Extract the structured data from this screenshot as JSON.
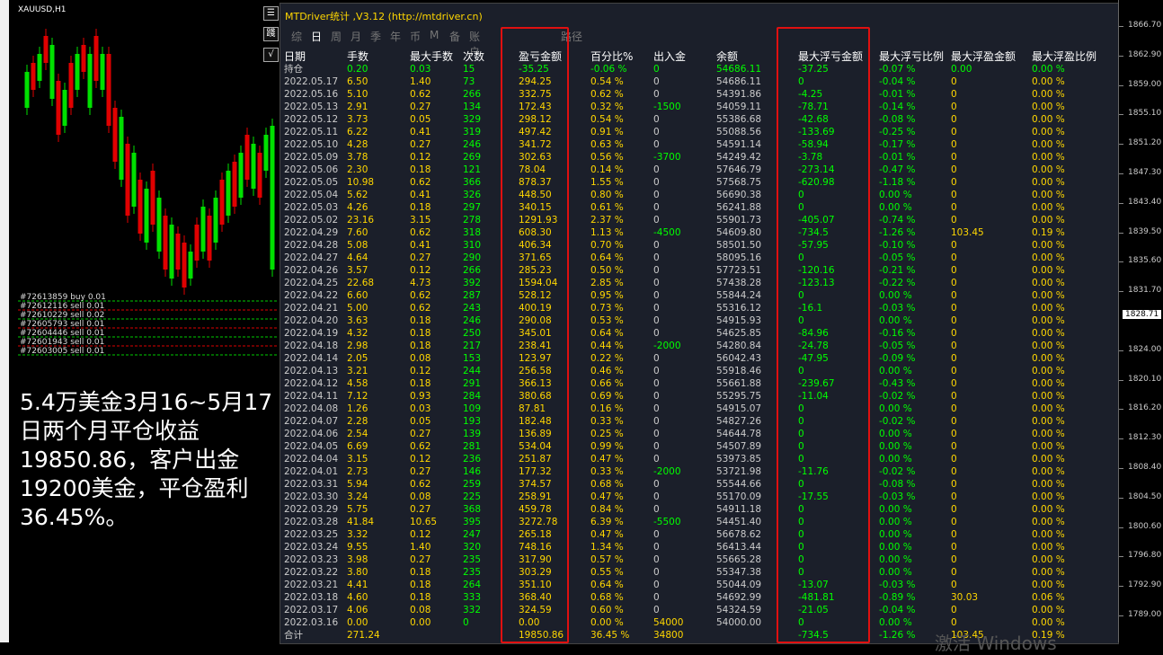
{
  "chart": {
    "symbol": "XAUUSD,H1",
    "orders": [
      "#72613859 buy 0.01",
      "#72612116 sell 0.01",
      "#72610229 sell 0.02",
      "#72605793 sell 0.01",
      "#72604446 sell 0.01",
      "#72601943 sell 0.01",
      "#72603005 sell 0.01"
    ],
    "overlay_text": "5.4万美金3月16~5月17日两个月平仓收益19850.86，客户出金19200美金，平仓盈利36.45%。",
    "buttons": [
      "☰",
      "踐",
      "√"
    ]
  },
  "panel": {
    "title": "MTDriver统计 ,V3.12 (http://mtdriver.cn)",
    "tabs": [
      "综",
      "日",
      "周",
      "月",
      "季",
      "年",
      "币",
      "M",
      "备",
      "账户",
      "路径"
    ],
    "active_tab": "日",
    "headers": [
      "日期",
      "手数",
      "最大手数",
      "次数",
      "盈亏金额",
      "百分比%",
      "出入金",
      "余额",
      "最大浮亏金额",
      "最大浮亏比例",
      "最大浮盈金额",
      "最大浮盈比例"
    ],
    "rows": [
      [
        "持仓",
        "0.20",
        "0.03",
        "15",
        "-35.25",
        "-0.06 %",
        "0",
        "54686.11",
        "-37.25",
        "-0.07 %",
        "0.00",
        "0.00 %"
      ],
      [
        "2022.05.17",
        "6.50",
        "1.40",
        "73",
        "294.25",
        "0.54 %",
        "0",
        "54686.11",
        "0",
        "-0.04 %",
        "0",
        "0.00 %"
      ],
      [
        "2022.05.16",
        "5.10",
        "0.62",
        "266",
        "332.75",
        "0.62 %",
        "0",
        "54391.86",
        "-4.25",
        "-0.01 %",
        "0",
        "0.00 %"
      ],
      [
        "2022.05.13",
        "2.91",
        "0.27",
        "134",
        "172.43",
        "0.32 %",
        "-1500",
        "54059.11",
        "-78.71",
        "-0.14 %",
        "0",
        "0.00 %"
      ],
      [
        "2022.05.12",
        "3.73",
        "0.05",
        "329",
        "298.12",
        "0.54 %",
        "0",
        "55386.68",
        "-42.68",
        "-0.08 %",
        "0",
        "0.00 %"
      ],
      [
        "2022.05.11",
        "6.22",
        "0.41",
        "319",
        "497.42",
        "0.91 %",
        "0",
        "55088.56",
        "-133.69",
        "-0.25 %",
        "0",
        "0.00 %"
      ],
      [
        "2022.05.10",
        "4.28",
        "0.27",
        "246",
        "341.72",
        "0.63 %",
        "0",
        "54591.14",
        "-58.94",
        "-0.17 %",
        "0",
        "0.00 %"
      ],
      [
        "2022.05.09",
        "3.78",
        "0.12",
        "269",
        "302.63",
        "0.56 %",
        "-3700",
        "54249.42",
        "-3.78",
        "-0.01 %",
        "0",
        "0.00 %"
      ],
      [
        "2022.05.06",
        "2.30",
        "0.18",
        "121",
        "78.04",
        "0.14 %",
        "0",
        "57646.79",
        "-273.14",
        "-0.47 %",
        "0",
        "0.00 %"
      ],
      [
        "2022.05.05",
        "10.98",
        "0.62",
        "366",
        "878.37",
        "1.55 %",
        "0",
        "57568.75",
        "-620.98",
        "-1.18 %",
        "0",
        "0.00 %"
      ],
      [
        "2022.05.04",
        "5.62",
        "0.41",
        "326",
        "448.50",
        "0.80 %",
        "0",
        "56690.38",
        "0",
        "0.00 %",
        "0",
        "0.00 %"
      ],
      [
        "2022.05.03",
        "4.26",
        "0.18",
        "297",
        "340.15",
        "0.61 %",
        "0",
        "56241.88",
        "0",
        "0.00 %",
        "0",
        "0.00 %"
      ],
      [
        "2022.05.02",
        "23.16",
        "3.15",
        "278",
        "1291.93",
        "2.37 %",
        "0",
        "55901.73",
        "-405.07",
        "-0.74 %",
        "0",
        "0.00 %"
      ],
      [
        "2022.04.29",
        "7.60",
        "0.62",
        "318",
        "608.30",
        "1.13 %",
        "-4500",
        "54609.80",
        "-734.5",
        "-1.26 %",
        "103.45",
        "0.19 %"
      ],
      [
        "2022.04.28",
        "5.08",
        "0.41",
        "310",
        "406.34",
        "0.70 %",
        "0",
        "58501.50",
        "-57.95",
        "-0.10 %",
        "0",
        "0.00 %"
      ],
      [
        "2022.04.27",
        "4.64",
        "0.27",
        "290",
        "371.65",
        "0.64 %",
        "0",
        "58095.16",
        "0",
        "-0.05 %",
        "0",
        "0.00 %"
      ],
      [
        "2022.04.26",
        "3.57",
        "0.12",
        "266",
        "285.23",
        "0.50 %",
        "0",
        "57723.51",
        "-120.16",
        "-0.21 %",
        "0",
        "0.00 %"
      ],
      [
        "2022.04.25",
        "22.68",
        "4.73",
        "392",
        "1594.04",
        "2.85 %",
        "0",
        "57438.28",
        "-123.13",
        "-0.22 %",
        "0",
        "0.00 %"
      ],
      [
        "2022.04.22",
        "6.60",
        "0.62",
        "287",
        "528.12",
        "0.95 %",
        "0",
        "55844.24",
        "0",
        "0.00 %",
        "0",
        "0.00 %"
      ],
      [
        "2022.04.21",
        "5.00",
        "0.62",
        "243",
        "400.19",
        "0.73 %",
        "0",
        "55316.12",
        "-16.1",
        "-0.03 %",
        "0",
        "0.00 %"
      ],
      [
        "2022.04.20",
        "3.63",
        "0.18",
        "246",
        "290.08",
        "0.53 %",
        "0",
        "54915.93",
        "0",
        "0.00 %",
        "0",
        "0.00 %"
      ],
      [
        "2022.04.19",
        "4.32",
        "0.18",
        "250",
        "345.01",
        "0.64 %",
        "0",
        "54625.85",
        "-84.96",
        "-0.16 %",
        "0",
        "0.00 %"
      ],
      [
        "2022.04.18",
        "2.98",
        "0.18",
        "217",
        "238.41",
        "0.44 %",
        "-2000",
        "54280.84",
        "-24.78",
        "-0.05 %",
        "0",
        "0.00 %"
      ],
      [
        "2022.04.14",
        "2.05",
        "0.08",
        "153",
        "123.97",
        "0.22 %",
        "0",
        "56042.43",
        "-47.95",
        "-0.09 %",
        "0",
        "0.00 %"
      ],
      [
        "2022.04.13",
        "3.21",
        "0.12",
        "244",
        "256.58",
        "0.46 %",
        "0",
        "55918.46",
        "0",
        "0.00 %",
        "0",
        "0.00 %"
      ],
      [
        "2022.04.12",
        "4.58",
        "0.18",
        "291",
        "366.13",
        "0.66 %",
        "0",
        "55661.88",
        "-239.67",
        "-0.43 %",
        "0",
        "0.00 %"
      ],
      [
        "2022.04.11",
        "7.12",
        "0.93",
        "284",
        "380.68",
        "0.69 %",
        "0",
        "55295.75",
        "-11.04",
        "-0.02 %",
        "0",
        "0.00 %"
      ],
      [
        "2022.04.08",
        "1.26",
        "0.03",
        "109",
        "87.81",
        "0.16 %",
        "0",
        "54915.07",
        "0",
        "0.00 %",
        "0",
        "0.00 %"
      ],
      [
        "2022.04.07",
        "2.28",
        "0.05",
        "193",
        "182.48",
        "0.33 %",
        "0",
        "54827.26",
        "0",
        "-0.02 %",
        "0",
        "0.00 %"
      ],
      [
        "2022.04.06",
        "2.54",
        "0.27",
        "139",
        "136.89",
        "0.25 %",
        "0",
        "54644.78",
        "0",
        "0.00 %",
        "0",
        "0.00 %"
      ],
      [
        "2022.04.05",
        "6.69",
        "0.62",
        "281",
        "534.04",
        "0.99 %",
        "0",
        "54507.89",
        "0",
        "0.00 %",
        "0",
        "0.00 %"
      ],
      [
        "2022.04.04",
        "3.15",
        "0.12",
        "236",
        "251.87",
        "0.47 %",
        "0",
        "53973.85",
        "0",
        "0.00 %",
        "0",
        "0.00 %"
      ],
      [
        "2022.04.01",
        "2.73",
        "0.27",
        "146",
        "177.32",
        "0.33 %",
        "-2000",
        "53721.98",
        "-11.76",
        "-0.02 %",
        "0",
        "0.00 %"
      ],
      [
        "2022.03.31",
        "5.94",
        "0.62",
        "259",
        "374.57",
        "0.68 %",
        "0",
        "55544.66",
        "0",
        "-0.08 %",
        "0",
        "0.00 %"
      ],
      [
        "2022.03.30",
        "3.24",
        "0.08",
        "225",
        "258.91",
        "0.47 %",
        "0",
        "55170.09",
        "-17.55",
        "-0.03 %",
        "0",
        "0.00 %"
      ],
      [
        "2022.03.29",
        "5.75",
        "0.27",
        "368",
        "459.78",
        "0.84 %",
        "0",
        "54911.18",
        "0",
        "0.00 %",
        "0",
        "0.00 %"
      ],
      [
        "2022.03.28",
        "41.84",
        "10.65",
        "395",
        "3272.78",
        "6.39 %",
        "-5500",
        "54451.40",
        "0",
        "0.00 %",
        "0",
        "0.00 %"
      ],
      [
        "2022.03.25",
        "3.32",
        "0.12",
        "247",
        "265.18",
        "0.47 %",
        "0",
        "56678.62",
        "0",
        "0.00 %",
        "0",
        "0.00 %"
      ],
      [
        "2022.03.24",
        "9.55",
        "1.40",
        "320",
        "748.16",
        "1.34 %",
        "0",
        "56413.44",
        "0",
        "0.00 %",
        "0",
        "0.00 %"
      ],
      [
        "2022.03.23",
        "3.98",
        "0.27",
        "235",
        "317.90",
        "0.57 %",
        "0",
        "55665.28",
        "0",
        "0.00 %",
        "0",
        "0.00 %"
      ],
      [
        "2022.03.22",
        "3.80",
        "0.18",
        "235",
        "303.29",
        "0.55 %",
        "0",
        "55347.38",
        "0",
        "0.00 %",
        "0",
        "0.00 %"
      ],
      [
        "2022.03.21",
        "4.41",
        "0.18",
        "264",
        "351.10",
        "0.64 %",
        "0",
        "55044.09",
        "-13.07",
        "-0.03 %",
        "0",
        "0.00 %"
      ],
      [
        "2022.03.18",
        "4.60",
        "0.18",
        "333",
        "368.40",
        "0.68 %",
        "0",
        "54692.99",
        "-481.81",
        "-0.89 %",
        "30.03",
        "0.06 %"
      ],
      [
        "2022.03.17",
        "4.06",
        "0.08",
        "332",
        "324.59",
        "0.60 %",
        "0",
        "54324.59",
        "-21.05",
        "-0.04 %",
        "0",
        "0.00 %"
      ],
      [
        "2022.03.16",
        "0.00",
        "0.00",
        "0",
        "0.00",
        "0.00 %",
        "54000",
        "54000.00",
        "0",
        "0.00 %",
        "0",
        "0.00 %"
      ]
    ],
    "total": [
      "合计",
      "271.24",
      "",
      "",
      "19850.86",
      "36.45 %",
      "34800",
      "",
      "-734.5",
      "-1.26 %",
      "103.45",
      "0.19 %"
    ]
  },
  "price_axis": {
    "ticks": [
      "1866.70",
      "1862.90",
      "1859.00",
      "1855.10",
      "1851.20",
      "1847.30",
      "1843.40",
      "1839.50",
      "1835.60",
      "1831.70",
      "1828.71",
      "1824.00",
      "1820.10",
      "1816.20",
      "1812.30",
      "1808.40",
      "1804.50",
      "1800.60",
      "1796.80",
      "1792.90",
      "1789.00"
    ],
    "current_price": "1828.71"
  },
  "watermark": "激活 Windows",
  "colors": {
    "bull": "#00e000",
    "bear": "#e00000",
    "accent": "#ffd700",
    "highlight": "#e01010"
  }
}
